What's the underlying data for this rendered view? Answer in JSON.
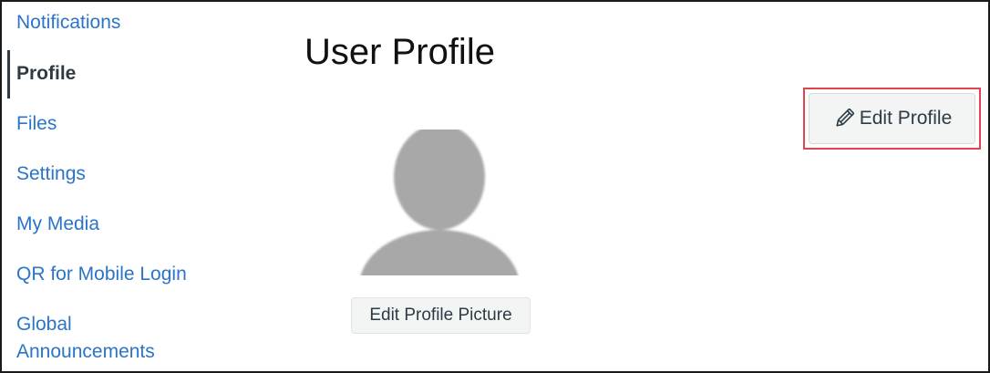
{
  "sidebar": {
    "items": [
      {
        "label": "Notifications"
      },
      {
        "label": "Profile"
      },
      {
        "label": "Files"
      },
      {
        "label": "Settings"
      },
      {
        "label": "My Media"
      },
      {
        "label": "QR for Mobile Login"
      },
      {
        "label_line1": "Global",
        "label_line2": "Announcements"
      }
    ],
    "active_index": 1
  },
  "main": {
    "title": "User Profile",
    "edit_profile_label": "Edit Profile",
    "edit_profile_icon": "pencil-icon",
    "avatar_icon": "default-avatar-icon",
    "edit_picture_label": "Edit Profile Picture"
  },
  "colors": {
    "link": "#2b74c7",
    "active_text": "#2d3b45",
    "highlight_border": "#e0454d",
    "button_bg": "#f3f4f4",
    "avatar_gray": "#a8a8a8"
  }
}
